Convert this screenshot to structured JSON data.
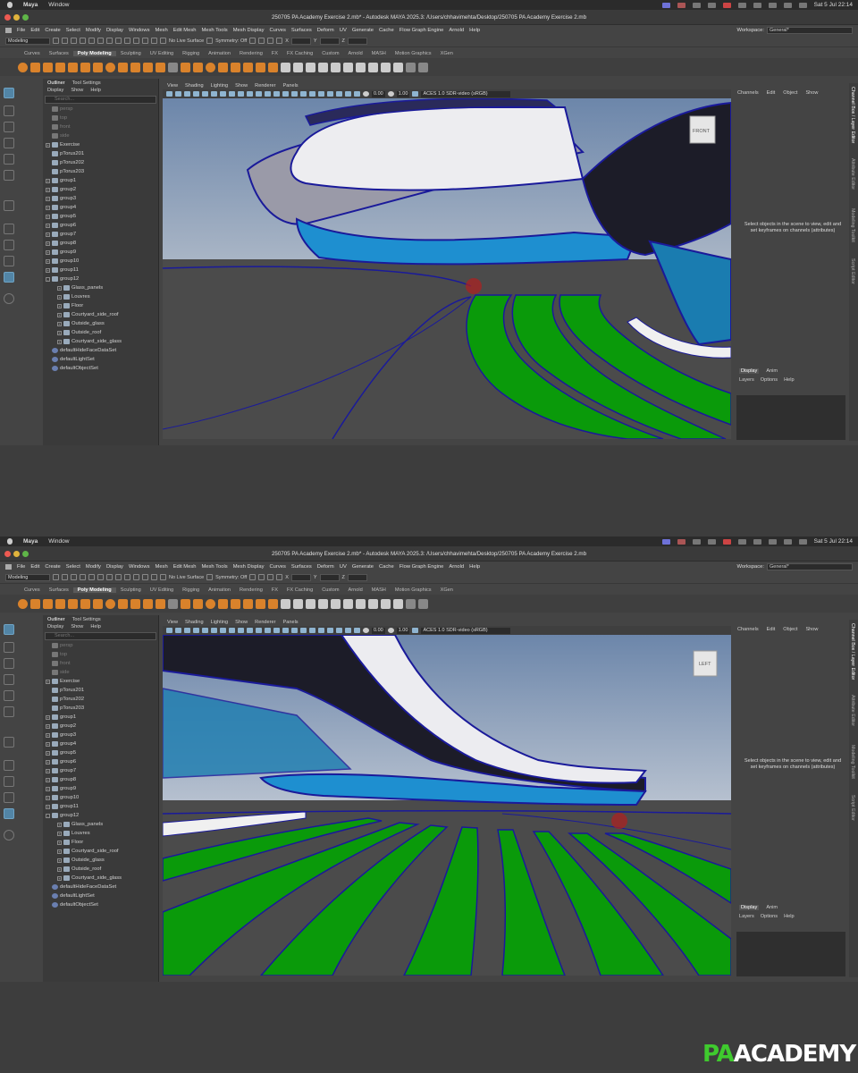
{
  "mac": {
    "app": "Maya",
    "window": "Window",
    "datetime": "Sat 5 Jul  22:14"
  },
  "title": "250705 PA Academy Exercise 2.mb* - Autodesk MAYA 2025.3: /Users/chhavimehta/Desktop/250705 PA Academy Exercise 2.mb",
  "menus": [
    "File",
    "Edit",
    "Create",
    "Select",
    "Modify",
    "Display",
    "Windows",
    "Mesh",
    "Edit Mesh",
    "Mesh Tools",
    "Mesh Display",
    "Curves",
    "Surfaces",
    "Deform",
    "UV",
    "Generate",
    "Cache",
    "Flow Graph Engine",
    "Arnold",
    "Help"
  ],
  "workspace": {
    "label": "Workspace:",
    "value": "General*"
  },
  "status": {
    "mode": "Modeling",
    "live": "No Live Surface",
    "symmetry": "Symmetry: Off",
    "x": "X",
    "y": "Y",
    "z": "Z"
  },
  "shelf_tabs": [
    "Curves",
    "Surfaces",
    "Poly Modeling",
    "Sculpting",
    "UV Editing",
    "Rigging",
    "Animation",
    "Rendering",
    "FX",
    "FX Caching",
    "Custom",
    "Arnold",
    "MASH",
    "Motion Graphics",
    "XGen"
  ],
  "active_shelf": "Poly Modeling",
  "outliner": {
    "tabs": [
      "Outliner",
      "Tool Settings"
    ],
    "menu": [
      "Display",
      "Show",
      "Help"
    ],
    "search": "Search...",
    "rows": [
      "persp",
      "top",
      "front",
      "side",
      "Exercise",
      "pTorus201",
      "pTorus202",
      "pTorus203",
      "group1",
      "group2",
      "group3",
      "group4",
      "group5",
      "group6",
      "group7",
      "group8",
      "group9",
      "group10",
      "group11",
      "group12",
      "Glass_panels",
      "Louvres",
      "Floor",
      "Courtyard_side_roof",
      "Outside_glass",
      "Outside_roof",
      "Courtyard_side_glass",
      "defaultHideFaceDataSet",
      "defaultLightSet",
      "defaultObjectSet"
    ]
  },
  "viewport": {
    "menu": [
      "View",
      "Shading",
      "Lighting",
      "Show",
      "Renderer",
      "Panels"
    ],
    "val1": "0.00",
    "val2": "1.00",
    "colorspace": "ACES 1.0 SDR-video (sRGB)",
    "cube_top": "FRONT",
    "cube_bottom": "LEFT"
  },
  "channelbox": {
    "menu": [
      "Channels",
      "Edit",
      "Object",
      "Show"
    ],
    "message": "Select objects in the scene to view, edit and set keyframes on channels (attributes)"
  },
  "layer": {
    "tabs": [
      "Display",
      "Anim"
    ],
    "menu": [
      "Layers",
      "Options",
      "Help"
    ]
  },
  "side_tabs": [
    "Channel Box / Layer Editor",
    "Attribute Editor",
    "Modeling Toolkit",
    "Script Editor"
  ],
  "logo": {
    "pa": "PA",
    "rest": "ACADEMY"
  },
  "colors": {
    "green": "#0a9a0a",
    "glass": "#1e8fd0",
    "outline": "#1a1a9a",
    "brand": "#3fca2e"
  }
}
